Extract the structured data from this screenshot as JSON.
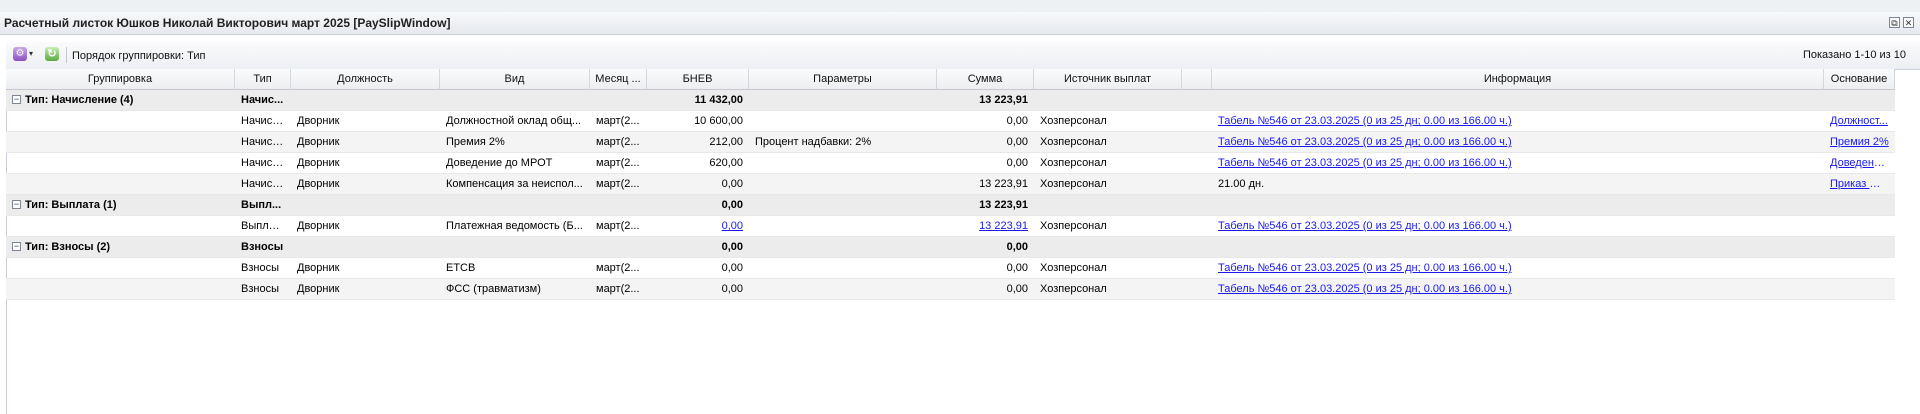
{
  "window": {
    "title": "Расчетный листок Юшков Николай Викторович март 2025 [PaySlipWindow]",
    "restore_icon": "⧉",
    "close_icon": "✕"
  },
  "toolbar": {
    "grouping_label": "Порядок группировки: Тип",
    "shown": "Показано 1-10 из 10",
    "gear_glyph": "⚙",
    "dropdown_glyph": "▾",
    "refresh_glyph": "↻"
  },
  "columns": [
    "Группировка",
    "Тип",
    "Должность",
    "Вид",
    "Месяц ...",
    "БНЕВ",
    "Параметры",
    "Сумма",
    "Источник выплат",
    "",
    "Информация",
    "Основание"
  ],
  "groups": [
    {
      "title": "Тип: Начисление (4)",
      "type": "Начис...",
      "bnev": "11 432,00",
      "sum": "13 223,91",
      "rows": [
        {
          "type": "Начисл...",
          "position": "Дворник",
          "kind": "Должностной оклад общ...",
          "month": "март(2...",
          "bnev": "10 600,00",
          "params": "",
          "sum": "0,00",
          "source": "Хозперсонал",
          "info": "Табель №546 от 23.03.2025 (0 из 25 дн; 0.00 из 166.00 ч.)",
          "basis": "Должност..."
        },
        {
          "type": "Начисл...",
          "position": "Дворник",
          "kind": "Премия 2%",
          "month": "март(2...",
          "bnev": "212,00",
          "params": "Процент надбавки: 2%",
          "sum": "0,00",
          "source": "Хозперсонал",
          "info": "Табель №546 от 23.03.2025 (0 из 25 дн; 0.00 из 166.00 ч.)",
          "basis": "Премия 2%"
        },
        {
          "type": "Начисл...",
          "position": "Дворник",
          "kind": "Доведение до МРОТ",
          "month": "март(2...",
          "bnev": "620,00",
          "params": "",
          "sum": "0,00",
          "source": "Хозперсонал",
          "info": "Табель №546 от 23.03.2025 (0 из 25 дн; 0.00 из 166.00 ч.)",
          "basis": "Доведени..."
        },
        {
          "type": "Начисл...",
          "position": "Дворник",
          "kind": "Компенсация за неиспол...",
          "month": "март(2...",
          "bnev": "0,00",
          "params": "",
          "sum": "13 223,91",
          "source": "Хозперсонал",
          "info": "21.00 дн.",
          "basis": "Приказ №..."
        }
      ]
    },
    {
      "title": "Тип: Выплата (1)",
      "type": "Выпл...",
      "bnev": "0,00",
      "sum": "13 223,91",
      "rows": [
        {
          "type": "Выплата",
          "position": "Дворник",
          "kind": "Платежная ведомость (Б...",
          "month": "март(2...",
          "bnev": "0,00",
          "params": "",
          "sum": "13 223,91",
          "source": "Хозперсонал",
          "info": "Табель №546 от 23.03.2025 (0 из 25 дн; 0.00 из 166.00 ч.)",
          "basis": ""
        }
      ]
    },
    {
      "title": "Тип: Взносы (2)",
      "type": "Взносы",
      "bnev": "0,00",
      "sum": "0,00",
      "rows": [
        {
          "type": "Взносы",
          "position": "Дворник",
          "kind": "ЕТСВ",
          "month": "март(2...",
          "bnev": "0,00",
          "params": "",
          "sum": "0,00",
          "source": "Хозперсонал",
          "info": "Табель №546 от 23.03.2025 (0 из 25 дн; 0.00 из 166.00 ч.)",
          "basis": ""
        },
        {
          "type": "Взносы",
          "position": "Дворник",
          "kind": "ФСС (травматизм)",
          "month": "март(2...",
          "bnev": "0,00",
          "params": "",
          "sum": "0,00",
          "source": "Хозперсонал",
          "info": "Табель №546 от 23.03.2025 (0 из 25 дн; 0.00 из 166.00 ч.)",
          "basis": ""
        }
      ]
    }
  ]
}
